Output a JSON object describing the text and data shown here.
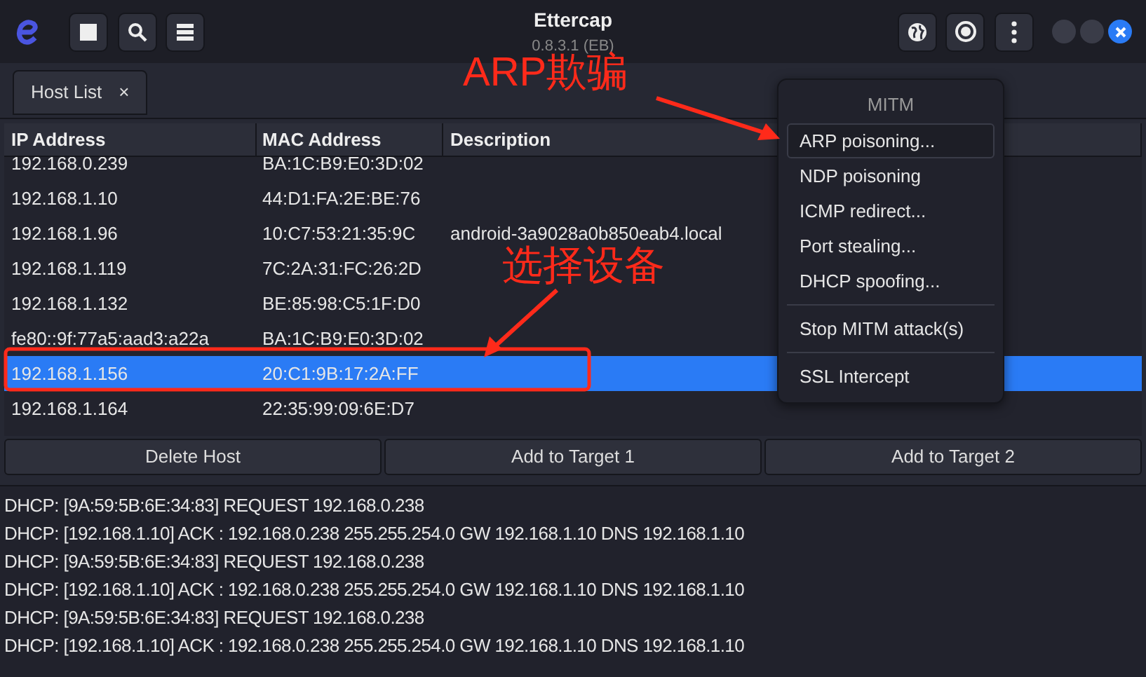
{
  "window": {
    "title": "Ettercap",
    "subtitle": "0.8.3.1 (EB)"
  },
  "tabs": [
    {
      "label": "Host List",
      "close": "×"
    }
  ],
  "table": {
    "columns": [
      "IP Address",
      "MAC Address",
      "Description"
    ],
    "rows": [
      {
        "cells": [
          "192.168.0.239",
          "BA:1C:B9:E0:3D:02",
          ""
        ],
        "selected": false
      },
      {
        "cells": [
          "192.168.1.10",
          "44:D1:FA:2E:BE:76",
          ""
        ],
        "selected": false
      },
      {
        "cells": [
          "192.168.1.96",
          "10:C7:53:21:35:9C",
          "android-3a9028a0b850eab4.local"
        ],
        "selected": false
      },
      {
        "cells": [
          "192.168.1.119",
          "7C:2A:31:FC:26:2D",
          ""
        ],
        "selected": false
      },
      {
        "cells": [
          "192.168.1.132",
          "BE:85:98:C5:1F:D0",
          ""
        ],
        "selected": false
      },
      {
        "cells": [
          "fe80::9f:77a5:aad3:a22a",
          "BA:1C:B9:E0:3D:02",
          ""
        ],
        "selected": false
      },
      {
        "cells": [
          "192.168.1.156",
          "20:C1:9B:17:2A:FF",
          ""
        ],
        "selected": true
      },
      {
        "cells": [
          "192.168.1.164",
          "22:35:99:09:6E:D7",
          ""
        ],
        "selected": false
      }
    ]
  },
  "buttons": [
    "Delete Host",
    "Add to Target 1",
    "Add to Target 2"
  ],
  "log": [
    "DHCP: [9A:59:5B:6E:34:83] REQUEST 192.168.0.238",
    "DHCP: [192.168.1.10] ACK : 192.168.0.238 255.255.254.0 GW 192.168.1.10 DNS 192.168.1.10",
    "DHCP: [9A:59:5B:6E:34:83] REQUEST 192.168.0.238",
    "DHCP: [192.168.1.10] ACK : 192.168.0.238 255.255.254.0 GW 192.168.1.10 DNS 192.168.1.10",
    "DHCP: [9A:59:5B:6E:34:83] REQUEST 192.168.0.238",
    "DHCP: [192.168.1.10] ACK : 192.168.0.238 255.255.254.0 GW 192.168.1.10 DNS 192.168.1.10"
  ],
  "menu": {
    "title": "MITM",
    "sections": [
      [
        {
          "label": "ARP poisoning...",
          "selected": true
        },
        {
          "label": "NDP poisoning",
          "selected": false
        },
        {
          "label": "ICMP redirect...",
          "selected": false
        },
        {
          "label": "Port stealing...",
          "selected": false
        },
        {
          "label": "DHCP spoofing...",
          "selected": false
        }
      ],
      [
        {
          "label": "Stop MITM attack(s)",
          "selected": false
        }
      ],
      [
        {
          "label": "SSL Intercept",
          "selected": false
        }
      ]
    ]
  },
  "annotations": [
    {
      "text": "ARP欺骗"
    },
    {
      "text": "选择设备"
    }
  ]
}
